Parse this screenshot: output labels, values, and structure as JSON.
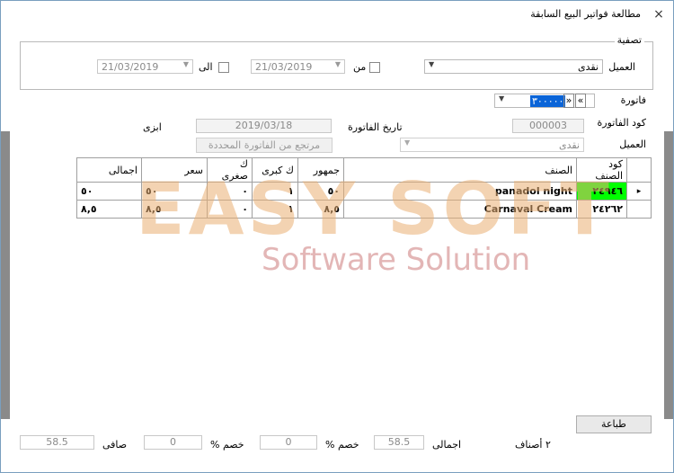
{
  "window": {
    "title": "مطالعة فواتير البيع السابقة",
    "close_glyph": "×"
  },
  "filter": {
    "legend": "تصفية",
    "customer_label": "العميل",
    "customer_value": "نقدى",
    "from_label": "من",
    "from_date": "21/03/2019",
    "to_label": "الى",
    "to_date": "21/03/2019"
  },
  "invoice": {
    "label": "فاتورة",
    "nav_first": "«",
    "nav_prev": "»",
    "number": "٣٠٠٠٠٠"
  },
  "details": {
    "code_label": "كود الفاتورة",
    "code_value": "000003",
    "date_label": "تاريخ الفاتورة",
    "date_value": "2019/03/18",
    "customer_label": "العميل",
    "customer_value": "نقدى",
    "user_value": "ابزى",
    "returns_button": "مرتجع من الفاتورة المحددة"
  },
  "table": {
    "headers": {
      "code": "كود الصنف",
      "item": "الصنف",
      "public": "جمهور",
      "big_qty": "ك كبرى",
      "small_qty": "ك صغرى",
      "price": "سعر",
      "total": "اجمالى"
    },
    "rows": [
      {
        "code": "٢٤٩٤٦",
        "item": "panadol night",
        "public": "٥٠",
        "big_qty": "١",
        "small_qty": "٠",
        "price": "٥٠",
        "total": "٥٠"
      },
      {
        "code": "٢٤٢٦٢",
        "item": "Carnaval Cream",
        "public": "٨,٥",
        "big_qty": "١",
        "small_qty": "٠",
        "price": "٨,٥",
        "total": "٨,٥"
      }
    ],
    "row_pointer": "▸"
  },
  "watermark": {
    "line1": "EASY SOFT",
    "line2": "Software Solution"
  },
  "footer": {
    "print_button": "طباعة",
    "items_count": "٢ أصناف",
    "total_label": "اجمالى",
    "total_value": "58.5",
    "discount_pct_label_1": "خصم %",
    "discount_pct_value_1": "0",
    "discount_pct_label_2": "خصم %",
    "discount_pct_value_2": "0",
    "net_label": "صافى",
    "net_value": "58.5"
  }
}
